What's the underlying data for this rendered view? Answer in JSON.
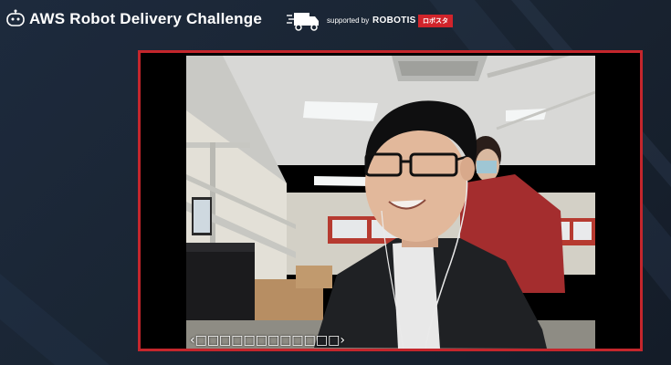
{
  "header": {
    "title": "AWS Robot Delivery Challenge",
    "supported_by": "supported by",
    "sponsor_name": "ROBOTIS",
    "sponsor_badge": "ロボスタ",
    "logo_icon": "robot-logo-icon",
    "truck_icon": "delivery-truck-icon"
  },
  "video": {
    "caption": "‹□□□□□□□□□□□□›",
    "border_color": "#c4262c"
  },
  "colors": {
    "background": "#1a2533",
    "accent_red": "#d1242b"
  }
}
